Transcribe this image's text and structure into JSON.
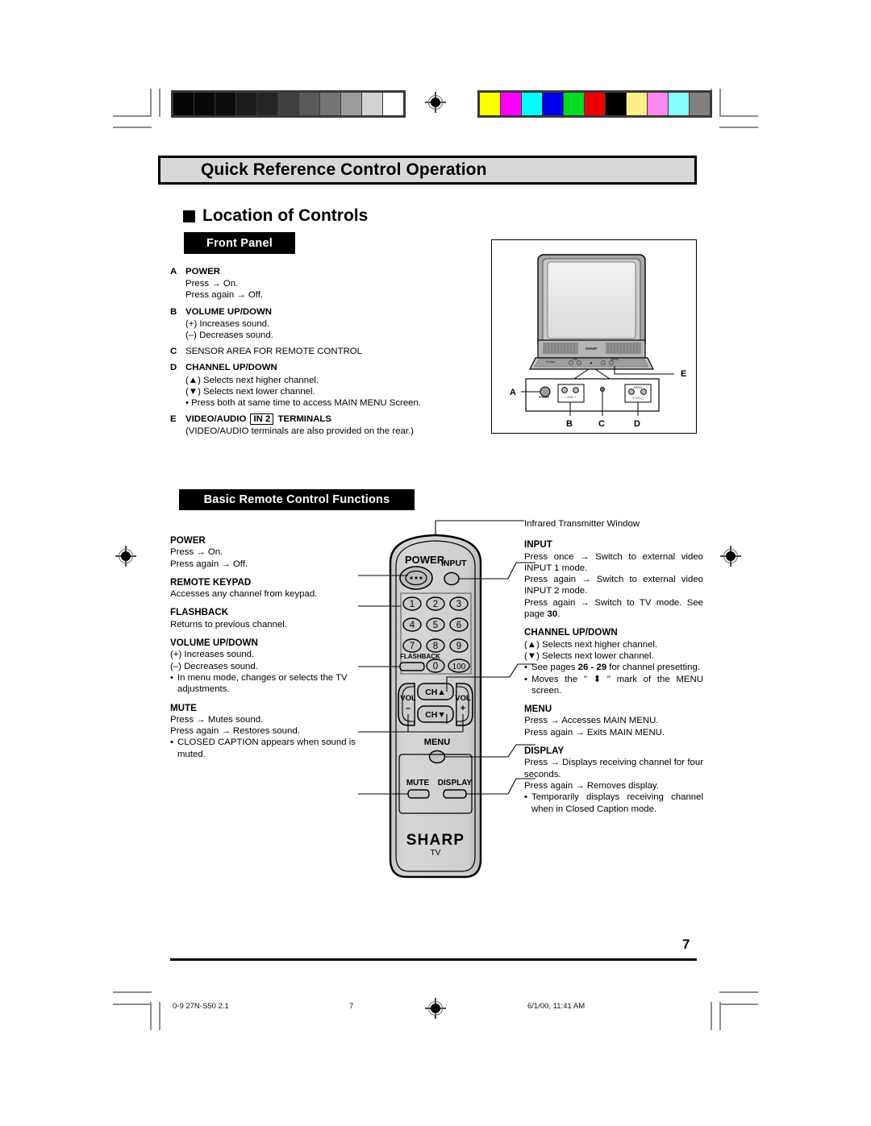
{
  "document": {
    "title": "Quick Reference Control Operation",
    "section_title": "Location of Controls",
    "page_number": "7"
  },
  "banners": {
    "front_panel": "Front Panel",
    "basic_remote": "Basic Remote Control Functions"
  },
  "front_panel": [
    {
      "letter": "A",
      "heading": "POWER",
      "bold": true,
      "lines": [
        "Press → On.",
        "Press again → Off."
      ]
    },
    {
      "letter": "B",
      "heading": "VOLUME UP/DOWN",
      "bold": true,
      "lines": [
        "(+) Increases sound.",
        "(–) Decreases sound."
      ]
    },
    {
      "letter": "C",
      "heading": "SENSOR AREA FOR REMOTE CONTROL",
      "bold": false,
      "lines": []
    },
    {
      "letter": "D",
      "heading": "CHANNEL UP/DOWN",
      "bold": true,
      "lines": [
        "(▲) Selects next higher channel.",
        "(▼) Selects next lower channel.",
        "• Press both at same time to access MAIN MENU Screen."
      ]
    },
    {
      "letter": "E",
      "heading_pre": "VIDEO/AUDIO",
      "heading_box": "IN 2",
      "heading_post": "TERMINALS",
      "bold": true,
      "lines": [
        "(VIDEO/AUDIO terminals are also provided on the rear.)"
      ]
    }
  ],
  "tv_figure": {
    "callouts": [
      "A",
      "B",
      "C",
      "D",
      "E"
    ],
    "brand": "SHARP",
    "button_labels": [
      "POWER",
      "VOL",
      "CH",
      "MENU"
    ]
  },
  "remote_left": [
    {
      "heading": "POWER",
      "lines": [
        "Press → On.",
        "Press again → Off."
      ],
      "bullets": []
    },
    {
      "heading": "REMOTE KEYPAD",
      "lines": [
        "Accesses any channel from keypad."
      ],
      "bullets": []
    },
    {
      "heading": "FLASHBACK",
      "lines": [
        "Returns to previous channel."
      ],
      "bullets": []
    },
    {
      "heading": "VOLUME UP/DOWN",
      "lines": [
        "(+) Increases sound.",
        "(–) Decreases sound."
      ],
      "bullets": [
        "In menu mode, changes or selects the TV adjustments."
      ]
    },
    {
      "heading": "MUTE",
      "lines": [
        "Press → Mutes sound.",
        "Press again → Restores sound."
      ],
      "bullets": [
        "CLOSED CAPTION appears when sound is muted."
      ]
    }
  ],
  "remote_right": {
    "transmitter_label": "Infrared Transmitter Window",
    "blocks": [
      {
        "heading": "INPUT",
        "lines": [
          "Press once → Switch to external video INPUT 1 mode.",
          "Press again → Switch to external video INPUT 2 mode.",
          "Press again → Switch to TV mode. See page 30."
        ],
        "bullets": []
      },
      {
        "heading": "CHANNEL UP/DOWN",
        "lines": [
          "(▲) Selects next higher channel.",
          "(▼) Selects next lower channel."
        ],
        "bullets": [
          "See pages 26 - 29 for channel presetting.",
          "Moves the \" ⬍ \" mark of the MENU screen."
        ]
      },
      {
        "heading": "MENU",
        "lines": [
          "Press → Accesses MAIN MENU.",
          "Press again → Exits MAIN MENU."
        ],
        "bullets": []
      },
      {
        "heading": "DISPLAY",
        "lines": [
          "Press → Displays receiving channel for four seconds.",
          "Press again → Removes display."
        ],
        "bullets": [
          "Temporarily displays receiving channel when in Closed Caption mode."
        ]
      }
    ]
  },
  "remote_figure": {
    "power_label": "POWER",
    "input_label": "INPUT",
    "flashback_label": "FLASHBACK",
    "menu_label": "MENU",
    "mute_label": "MUTE",
    "display_label": "DISPLAY",
    "vol_label": "VOL",
    "vol_minus": "–",
    "vol_plus": "+",
    "ch_up": "CH▲",
    "ch_down": "CH▼",
    "keypad": [
      "1",
      "2",
      "3",
      "4",
      "5",
      "6",
      "7",
      "8",
      "9",
      "0",
      "100"
    ],
    "brand": "SHARP",
    "brand_sub": "TV"
  },
  "calibration": {
    "gray_swatches": [
      "#050505",
      "#070707",
      "#0d0d0d",
      "#1c1c1c",
      "#262626",
      "#414141",
      "#5a5a5a",
      "#757575",
      "#9c9c9c",
      "#d2d2d2",
      "#ffffff"
    ],
    "color_swatches": [
      "#ffff00",
      "#ff00ff",
      "#00ffff",
      "#0000ee",
      "#00dd22",
      "#ee0000",
      "#000000",
      "#ffee88",
      "#ff88ee",
      "#88ffff",
      "#808080"
    ]
  },
  "footer": {
    "left": "0-9 27N-S50 2.1",
    "center": "7",
    "right": "6/1/00, 11:41 AM"
  }
}
